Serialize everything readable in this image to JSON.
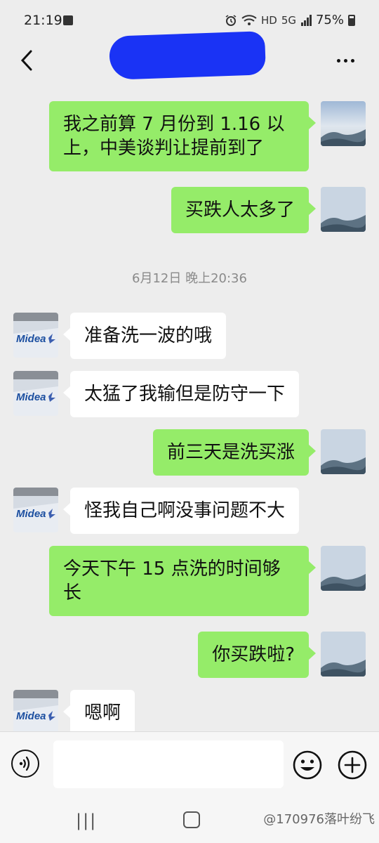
{
  "status_bar": {
    "time": "21:19",
    "hd_label": "HD",
    "net_label": "5G",
    "battery": "75%"
  },
  "header": {
    "title": "",
    "back_icon": "chevron-left-icon",
    "more_icon": "more-dots-icon"
  },
  "messages": [
    {
      "sender": "me",
      "text": "我之前算 7 月份到 1.16 以上，中美谈判让提前到了"
    },
    {
      "sender": "me",
      "text": "买跌人太多了"
    },
    {
      "type": "time",
      "text": "6月12日 晚上20:36"
    },
    {
      "sender": "them",
      "text": "准备洗一波的哦"
    },
    {
      "sender": "them",
      "text": "太猛了我输但是防守一下"
    },
    {
      "sender": "me",
      "text": "前三天是洗买涨"
    },
    {
      "sender": "them",
      "text": "怪我自己啊没事问题不大"
    },
    {
      "sender": "me",
      "text": "今天下午 15 点洗的时间够长"
    },
    {
      "sender": "me",
      "text": "你买跌啦?"
    },
    {
      "sender": "them",
      "text": "嗯啊"
    }
  ],
  "avatars": {
    "them_logo_text": "Midea"
  },
  "input_bar": {
    "voice_icon": "voice-icon",
    "emoji_icon": "emoji-icon",
    "plus_icon": "plus-icon",
    "placeholder": ""
  },
  "system_nav": {
    "recent_label": "|||",
    "watermark": "@170976落叶纷飞"
  }
}
